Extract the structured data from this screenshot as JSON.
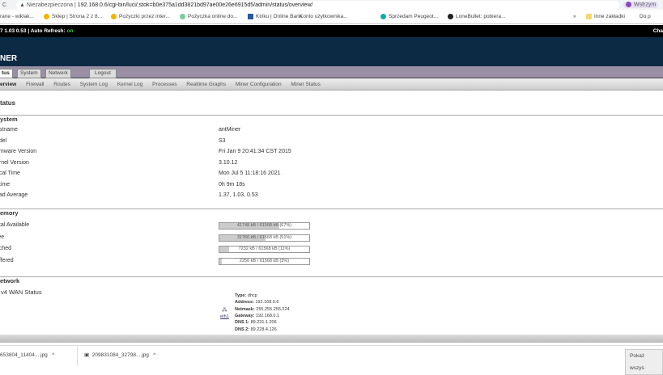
{
  "browser": {
    "security": "Niezabezpieczona",
    "url": "192.168.0.6/cgi-bin/luci/;stok=b0e375a1dd3821bd97ae00e26e6915d5/admin/status/overview/",
    "profile": "Wstrzym",
    "bookmarks": [
      "rane - wiklak...",
      "Sklep | Strona 2 z 8...",
      "Pożyczki przez inter...",
      "Pożyczka online do...",
      "Kiriku | Online Bank",
      "Konto użytkownika...",
      "Sprzedam Peugeot...",
      "LoneBullet: pobiera...",
      "»",
      "Inne zakładki",
      "Do p"
    ]
  },
  "topbar": {
    "load": "7 1.03 0.53 | Auto Refresh: ",
    "refresh": "on",
    "right": "Cha"
  },
  "header": {
    "title": "NER"
  },
  "tabs": [
    "tus",
    "System",
    "Network",
    "Logout"
  ],
  "subtabs": [
    "erview",
    "Firewall",
    "Routes",
    "System Log",
    "Kernel Log",
    "Processes",
    "Realtime Graphs",
    "Miner Configuration",
    "Miner Status"
  ],
  "page_title": "tatus",
  "system": {
    "title": "ystem",
    "rows": [
      {
        "label": "ostname",
        "value": "antMiner"
      },
      {
        "label": "odel",
        "value": "S3"
      },
      {
        "label": "irmware Version",
        "value": "Fri Jan 9 20:41:34 CST 2015"
      },
      {
        "label": "ernel Version",
        "value": "3.10.12"
      },
      {
        "label": "ocal Time",
        "value": "Mon Jul 5 11:18:16 2021"
      },
      {
        "label": "ptime",
        "value": "0h 9m 18s"
      },
      {
        "label": "oad Average",
        "value": "1.37, 1.03, 0.53"
      }
    ]
  },
  "memory": {
    "title": "emory",
    "rows": [
      {
        "label": "otal Available",
        "text": "41748 kB / 61568 kB (67%)",
        "percent": 67
      },
      {
        "label": "ree",
        "text": "31760 kB / 61568 kB (51%)",
        "percent": 51
      },
      {
        "label": "ached",
        "text": "7232 kB / 61568 kB (11%)",
        "percent": 11
      },
      {
        "label": "uffered",
        "text": "2256 kB / 61568 kB (3%)",
        "percent": 3
      }
    ]
  },
  "network": {
    "title": "etwork",
    "wan_label": "v4 WAN Status",
    "iface": "eth1",
    "details": [
      {
        "k": "Type:",
        "v": "dhcp"
      },
      {
        "k": "Address:",
        "v": "192.168.0.6"
      },
      {
        "k": "Netmask:",
        "v": "255.255.255.224"
      },
      {
        "k": "Gateway:",
        "v": "192.168.0.1"
      },
      {
        "k": "DNS 1:",
        "v": "89.231.1.206"
      },
      {
        "k": "DNS 2:",
        "v": "89.228.4.126"
      }
    ]
  },
  "downloads": {
    "items": [
      "653804_11404....jpg",
      "209831084_32798....jpg"
    ],
    "show_all": "Pokaż wszys"
  }
}
